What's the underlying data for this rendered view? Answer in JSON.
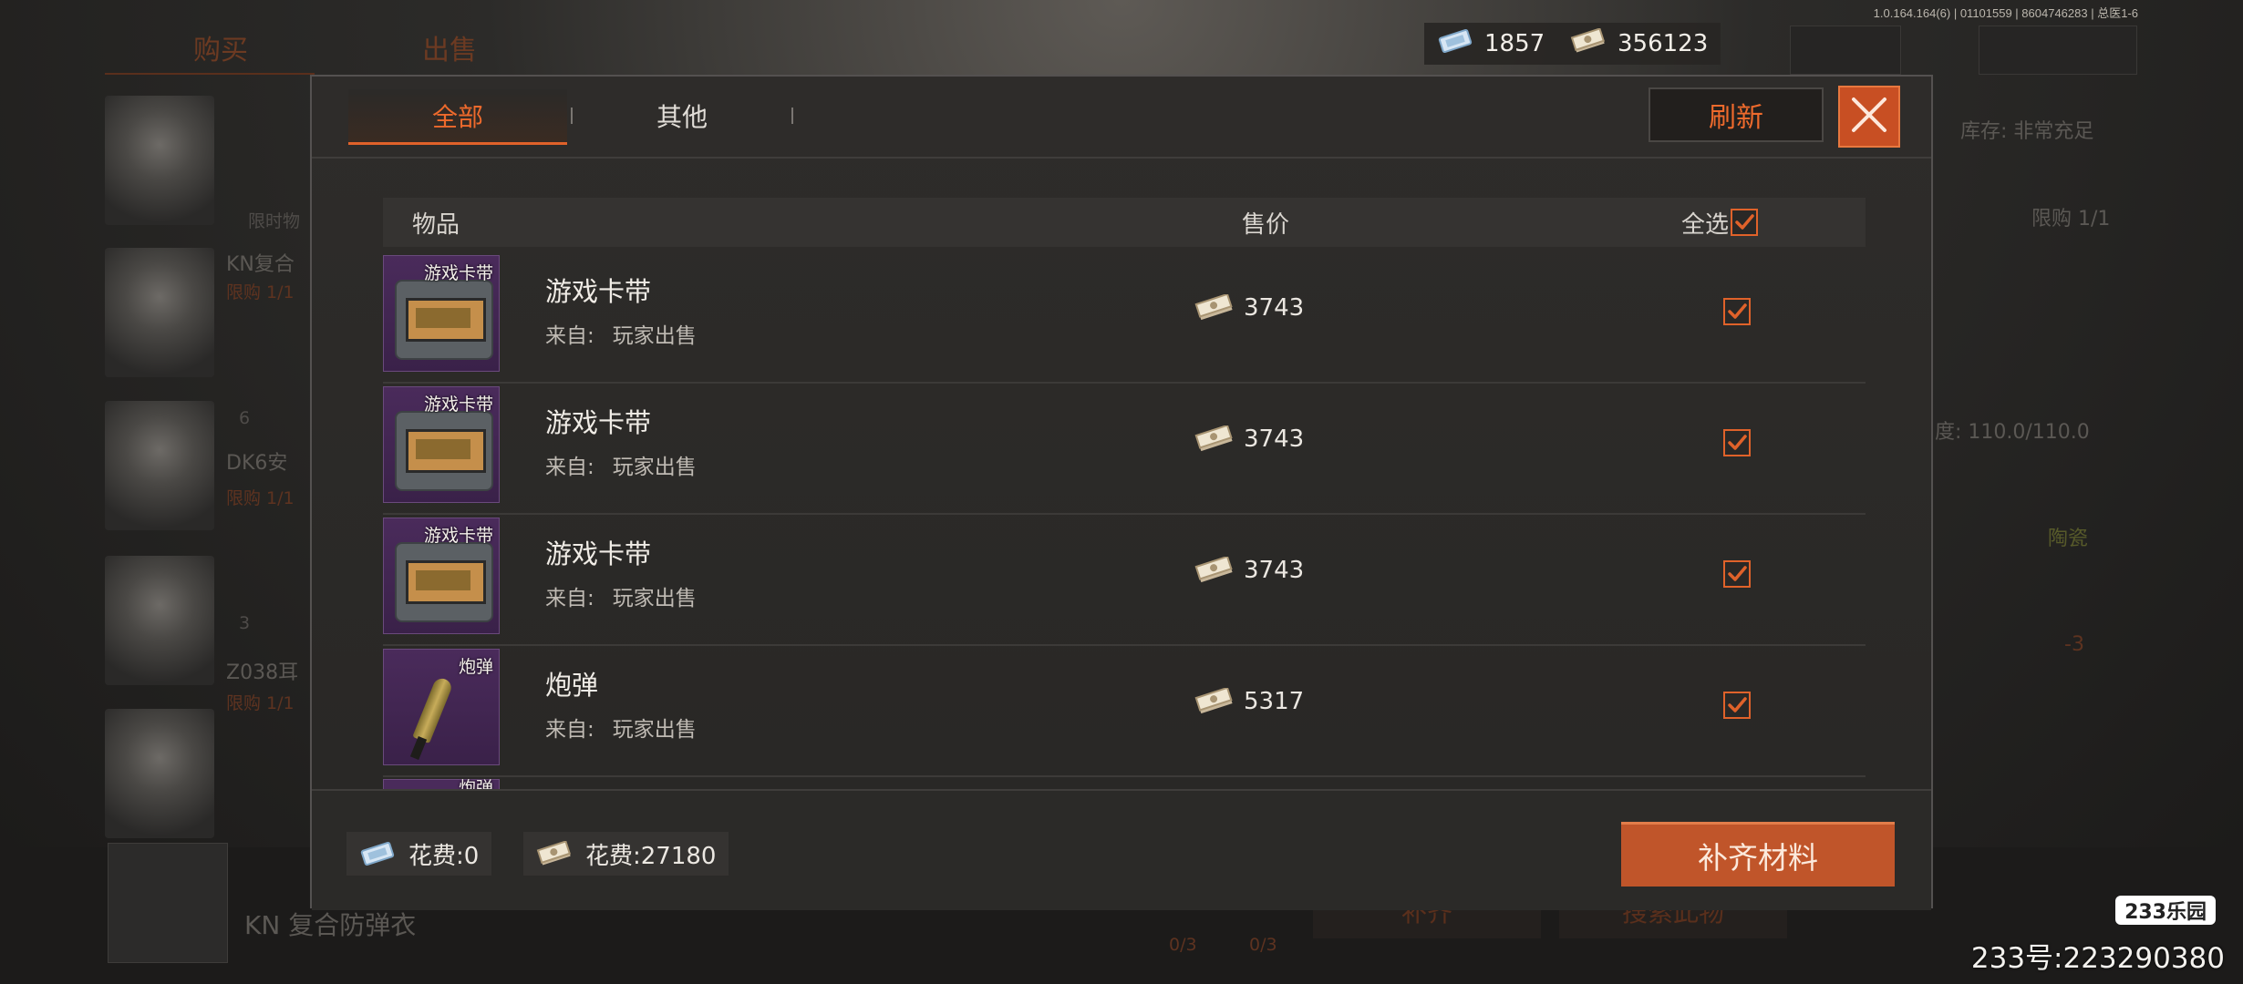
{
  "version_text": "1.0.164.164(6) | 01101559 | 8604746283 | 总医1-6",
  "currencies": [
    {
      "icon": "ticket-currency-icon",
      "value": "1857"
    },
    {
      "icon": "banknote-icon",
      "value": "356123"
    }
  ],
  "background": {
    "tabs": [
      "购买",
      "出售"
    ],
    "items": [
      {
        "name": "KN复合",
        "limit": "限购 1/1"
      },
      {
        "name": "DK6安",
        "limit": "限购 1/1",
        "badge": "6"
      },
      {
        "name": "Z038耳",
        "limit": "限购 1/1",
        "badge": "3"
      }
    ],
    "limited_label": "限时物",
    "stock_label": "库存: 非常充足",
    "limit_right": "限购 1/1",
    "durability": "度: 110.0/110.0",
    "material": "陶瓷",
    "delta": "-3",
    "selected_item": "KN 复合防弹衣",
    "bottom_counts": [
      "0/3",
      "0/3"
    ],
    "bottom_buttons": [
      "补齐",
      "搜索此物"
    ]
  },
  "modal": {
    "tabs": [
      {
        "label": "全部",
        "active": true
      },
      {
        "label": "其他",
        "active": false
      }
    ],
    "refresh_label": "刷新",
    "columns": {
      "item": "物品",
      "price": "售价",
      "select_all": "全选"
    },
    "select_all_checked": true,
    "rows": [
      {
        "thumb_label": "游戏卡带",
        "name": "游戏卡带",
        "from_label": "来自:",
        "from_value": "玩家出售",
        "price": "3743",
        "checked": true,
        "icon": "game-cartridge-icon"
      },
      {
        "thumb_label": "游戏卡带",
        "name": "游戏卡带",
        "from_label": "来自:",
        "from_value": "玩家出售",
        "price": "3743",
        "checked": true,
        "icon": "game-cartridge-icon"
      },
      {
        "thumb_label": "游戏卡带",
        "name": "游戏卡带",
        "from_label": "来自:",
        "from_value": "玩家出售",
        "price": "3743",
        "checked": true,
        "icon": "game-cartridge-icon"
      },
      {
        "thumb_label": "炮弹",
        "name": "炮弹",
        "from_label": "来自:",
        "from_value": "玩家出售",
        "price": "5317",
        "checked": true,
        "icon": "artillery-shell-icon"
      }
    ],
    "partial_row_label": "炮弹",
    "costs": [
      {
        "icon": "ticket-currency-icon",
        "text": "花费:0"
      },
      {
        "icon": "banknote-icon",
        "text": "花费:27180"
      }
    ],
    "fill_button": "补齐材料"
  },
  "watermark": {
    "badge": "233乐园",
    "id": "233号:223290380"
  },
  "colors": {
    "accent": "#e0622a",
    "button": "#c0552a",
    "panel": "#2e2c2a"
  }
}
